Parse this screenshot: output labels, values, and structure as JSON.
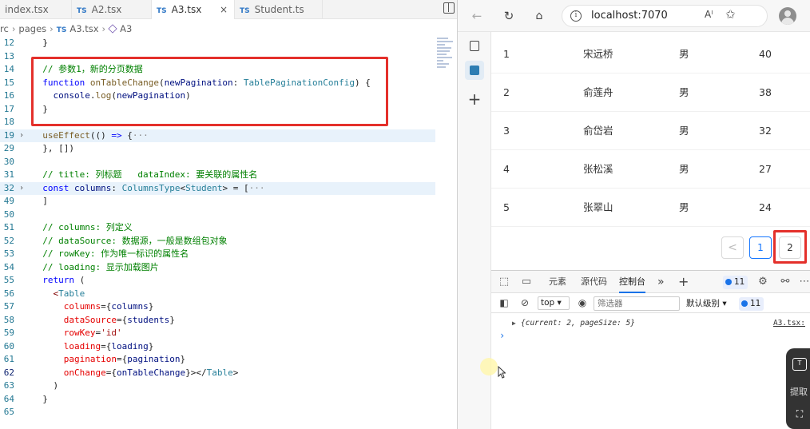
{
  "editor": {
    "tabs": [
      {
        "label": "index.tsx",
        "ts": false
      },
      {
        "label": "A2.tsx",
        "ts": true
      },
      {
        "label": "A3.tsx",
        "ts": true
      },
      {
        "label": "Student.ts",
        "ts": true
      }
    ],
    "ts_badge": "TS",
    "close_glyph": "×",
    "breadcrumb": {
      "root": "rc",
      "folder": "pages",
      "file": "A3.tsx",
      "symbol": "A3"
    },
    "code_lines": [
      {
        "num": "12",
        "html": "  }"
      },
      {
        "num": "13",
        "html": ""
      },
      {
        "num": "14",
        "html": "  <span class='cm'>// 参数1，新的分页数据</span>"
      },
      {
        "num": "15",
        "html": "  <span class='kw'>function</span> <span class='fn'>onTableChange</span>(<span class='pm'>newPagination</span>: <span class='ty'>TablePaginationConfig</span>) {"
      },
      {
        "num": "16",
        "html": "    <span class='pm'>console</span>.<span class='fn'>log</span>(<span class='pm'>newPagination</span>)"
      },
      {
        "num": "17",
        "html": "  }"
      },
      {
        "num": "18",
        "html": ""
      },
      {
        "num": "19",
        "html": "  <span class='fn'>useEffect</span>(() <span class='kw'>=&gt;</span> {<span style='color:#888'>···</span>",
        "fold": true,
        "hl": true
      },
      {
        "num": "29",
        "html": "  }, [])"
      },
      {
        "num": "30",
        "html": ""
      },
      {
        "num": "31",
        "html": "  <span class='cm'>// title: 列标题   dataIndex: 要关联的属性名</span>"
      },
      {
        "num": "32",
        "html": "  <span class='kw'>const</span> <span class='pm'>columns</span>: <span class='ty'>ColumnsType</span>&lt;<span class='ty'>Student</span>&gt; = [<span style='color:#888'>···</span>",
        "fold": true,
        "hl": true
      },
      {
        "num": "49",
        "html": "  ]"
      },
      {
        "num": "50",
        "html": ""
      },
      {
        "num": "51",
        "html": "  <span class='cm'>// columns: 列定义</span>"
      },
      {
        "num": "52",
        "html": "  <span class='cm'>// dataSource: 数据源，一般是数组包对象</span>"
      },
      {
        "num": "53",
        "html": "  <span class='cm'>// rowKey: 作为唯一标识的属性名</span>"
      },
      {
        "num": "54",
        "html": "  <span class='cm'>// loading: 显示加载图片</span>"
      },
      {
        "num": "55",
        "html": "  <span class='kw'>return</span> ("
      },
      {
        "num": "56",
        "html": "    <span class='tg'>&lt;</span><span class='ty'>Table</span>"
      },
      {
        "num": "57",
        "html": "      <span class='at'>columns</span>={<span class='pm'>columns</span>}"
      },
      {
        "num": "58",
        "html": "      <span class='at'>dataSource</span>={<span class='pm'>students</span>}"
      },
      {
        "num": "59",
        "html": "      <span class='at'>rowKey</span>=<span class='st'>'id'</span>"
      },
      {
        "num": "60",
        "html": "      <span class='at'>loading</span>={<span class='pm'>loading</span>}"
      },
      {
        "num": "61",
        "html": "      <span class='at'>pagination</span>={<span class='pm'>pagination</span>}"
      },
      {
        "num": "62",
        "html": "      <span class='at'>onChange</span>={<span class='pm'>onTableChange</span>}&gt;&lt;/<span class='ty'>Table</span>&gt;",
        "current": true
      },
      {
        "num": "63",
        "html": "    )"
      },
      {
        "num": "64",
        "html": "  }"
      },
      {
        "num": "65",
        "html": ""
      }
    ]
  },
  "browser": {
    "url": "localhost:7070",
    "read_aloud": "Aˡ",
    "favorite_glyph": "✩",
    "table_rows": [
      {
        "id": "1",
        "name": "宋远桥",
        "sex": "男",
        "age": "40"
      },
      {
        "id": "2",
        "name": "俞莲舟",
        "sex": "男",
        "age": "38"
      },
      {
        "id": "3",
        "name": "俞岱岩",
        "sex": "男",
        "age": "32"
      },
      {
        "id": "4",
        "name": "张松溪",
        "sex": "男",
        "age": "27"
      },
      {
        "id": "5",
        "name": "张翠山",
        "sex": "男",
        "age": "24"
      }
    ],
    "pagination": {
      "prev": "<",
      "pages": [
        "1",
        "2"
      ]
    },
    "devtools": {
      "tabs": [
        "元素",
        "源代码",
        "控制台"
      ],
      "active_tab": "控制台",
      "more": "»",
      "add": "+",
      "issue_count": "11",
      "context": "top",
      "filter_placeholder": "筛选器",
      "level": "默认级别",
      "level_count": "11",
      "log_object": "{current: 2, pageSize: 5}",
      "log_source": "A3.tsx:",
      "prompt": "›"
    }
  },
  "widget": {
    "label": "提取"
  }
}
